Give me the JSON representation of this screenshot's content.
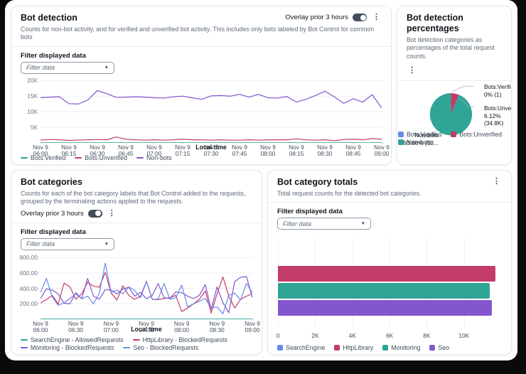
{
  "panels": {
    "bot_detection": {
      "title": "Bot detection",
      "subtitle": "Counts for non-bot activity, and for verified and unverified bot activity. This includes only bots labeled by Bot Control for common bots",
      "overlay_label": "Overlay prior 3 hours",
      "filter_label": "Filter displayed data",
      "filter_placeholder": "Filter data",
      "xaxis_title": "Local time",
      "legend": [
        {
          "label": "Bots:Verified",
          "color": "#2ea597"
        },
        {
          "label": "Bots:Unverified",
          "color": "#c33d69"
        },
        {
          "label": "Non-bots",
          "color": "#8456ce"
        }
      ]
    },
    "bot_detection_percentages": {
      "title": "Bot detection percentages",
      "subtitle": "Bot detection categories as percentages of the total request counts.",
      "legend": [
        {
          "label": "Bots:Verified",
          "color": "#688ae8"
        },
        {
          "label": "Bots:Unverified",
          "color": "#c33d69"
        },
        {
          "label": "Non-bots",
          "color": "#2ea597"
        }
      ]
    },
    "bot_categories": {
      "title": "Bot categories",
      "subtitle": "Counts for each of the bot category labels that Bot Control added to the requests, grouped by the terminating actions applied to the requests.",
      "overlay_label": "Overlay prior 3 hours",
      "filter_label": "Filter displayed data",
      "filter_placeholder": "Filter data",
      "xaxis_title": "Local time",
      "legend": [
        {
          "label": "SearchEngine - AllowedRequests",
          "color": "#2ea597"
        },
        {
          "label": "HttpLibrary - BlockedRequests",
          "color": "#c33d69"
        },
        {
          "label": "Monitoring - BlockedRequests",
          "color": "#8456ce"
        },
        {
          "label": "Seo - BlockedRequests",
          "color": "#688ae8"
        }
      ]
    },
    "bot_category_totals": {
      "title": "Bot category totals",
      "subtitle": "Total request counts for the detected bot categories.",
      "filter_label": "Filter displayed data",
      "filter_placeholder": "Filter data",
      "legend": [
        {
          "label": "SearchEngine",
          "color": "#688ae8"
        },
        {
          "label": "HttpLibrary",
          "color": "#c33d69"
        },
        {
          "label": "Monitoring",
          "color": "#2ea597"
        },
        {
          "label": "Seo",
          "color": "#8456ce"
        }
      ]
    }
  },
  "chart_data": {
    "bot_detection": {
      "type": "line",
      "ymax": 21000,
      "yticks": [
        {
          "label": "20K",
          "v": 20000
        },
        {
          "label": "15K",
          "v": 15000
        },
        {
          "label": "10K",
          "v": 10000
        },
        {
          "label": "5K",
          "v": 5000
        }
      ],
      "x_tick_labels": [
        [
          "Nov 9",
          "06:00"
        ],
        [
          "Nov 9",
          "06:15"
        ],
        [
          "Nov 9",
          "06:30"
        ],
        [
          "Nov 9",
          "06:45"
        ],
        [
          "Nov 9",
          "07:00"
        ],
        [
          "Nov 9",
          "07:15"
        ],
        [
          "Nov 9",
          "07:30"
        ],
        [
          "Nov 9",
          "07:45"
        ],
        [
          "Nov 9",
          "08:00"
        ],
        [
          "Nov 9",
          "08:15"
        ],
        [
          "Nov 9",
          "08:30"
        ],
        [
          "Nov 9",
          "08:45"
        ],
        [
          "Nov 9",
          "09:00"
        ]
      ],
      "xlabel": "Local time",
      "series": [
        {
          "name": "Bots:Verified",
          "color": "#2ea597",
          "values": [
            20,
            20,
            20,
            20,
            20,
            20,
            20,
            20,
            20,
            20,
            20,
            20,
            20,
            20,
            20,
            20,
            20,
            20,
            20,
            20,
            20,
            20,
            20,
            20,
            20,
            20,
            20,
            20,
            20,
            20,
            20,
            20,
            20,
            20,
            20,
            20,
            20
          ]
        },
        {
          "name": "Bots:Unverified",
          "color": "#c33d69",
          "values": [
            900,
            1100,
            1000,
            800,
            900,
            1000,
            1100,
            1000,
            1900,
            1200,
            1000,
            900,
            1000,
            900,
            1000,
            1200,
            1000,
            1000,
            900,
            1000,
            900,
            900,
            1000,
            900,
            1000,
            1000,
            1000,
            1300,
            1000,
            900,
            1000,
            700,
            1100,
            1200,
            1000,
            1400,
            1200
          ]
        },
        {
          "name": "Non-bots",
          "color": "#8456ce",
          "values": [
            14500,
            14700,
            14800,
            12600,
            12500,
            13800,
            16800,
            15800,
            14600,
            14700,
            14800,
            14700,
            14500,
            14400,
            14800,
            15000,
            14500,
            14000,
            15100,
            15200,
            15000,
            15600,
            14700,
            15600,
            14500,
            14400,
            14900,
            13100,
            14000,
            15200,
            16600,
            14800,
            12700,
            14200,
            13100,
            15500,
            11200
          ]
        }
      ]
    },
    "bot_detection_percentages": {
      "type": "pie",
      "slices": [
        {
          "name": "Bots:Verified",
          "pct": 0,
          "display_label": "Bots:Verified",
          "display_value": "0% (1)",
          "color": "#688ae8"
        },
        {
          "name": "Bots:Unverified",
          "pct": 6.12,
          "display_label": "Bots:Unverif...",
          "display_value": "6.12% (34.8K)",
          "color": "#c33d69"
        },
        {
          "name": "Non-bots",
          "pct": 93.88,
          "display_label": "Non-bots",
          "display_value": "93.88% (53...",
          "color": "#2ea597"
        }
      ]
    },
    "bot_categories": {
      "type": "line",
      "ymax": 850,
      "yticks": [
        {
          "label": "800.00",
          "v": 800
        },
        {
          "label": "600.00",
          "v": 600
        },
        {
          "label": "400.00",
          "v": 400
        },
        {
          "label": "200.00",
          "v": 200
        }
      ],
      "x_tick_labels": [
        [
          "Nov 9",
          "06:00"
        ],
        [
          "Nov 9",
          "06:30"
        ],
        [
          "Nov 9",
          "07:00"
        ],
        [
          "Nov 9",
          "07:30"
        ],
        [
          "Nov 9",
          "08:00"
        ],
        [
          "Nov 9",
          "08:30"
        ],
        [
          "Nov 9",
          "09:00"
        ]
      ],
      "xlabel": "Local time",
      "series": [
        {
          "name": "SearchEngine - AllowedRequests",
          "color": "#2ea597",
          "values": [
            2,
            2,
            2,
            2,
            2,
            2,
            2,
            2,
            2,
            2,
            2,
            2,
            2,
            2,
            2,
            2,
            2,
            2,
            2,
            2,
            2,
            2,
            2,
            2,
            2,
            2,
            2,
            2,
            2,
            2,
            2,
            2,
            2,
            2,
            2,
            2,
            2
          ]
        },
        {
          "name": "HttpLibrary - BlockedRequests",
          "color": "#c33d69",
          "values": [
            210,
            255,
            310,
            200,
            470,
            420,
            260,
            330,
            480,
            430,
            415,
            610,
            340,
            250,
            435,
            310,
            260,
            300,
            495,
            260,
            255,
            270,
            280,
            310,
            100,
            145,
            200,
            260,
            370,
            80,
            330,
            550,
            300,
            145,
            260,
            300,
            330
          ]
        },
        {
          "name": "Monitoring - BlockedRequests",
          "color": "#8456ce",
          "values": [
            270,
            395,
            380,
            330,
            210,
            200,
            345,
            265,
            530,
            300,
            260,
            385,
            380,
            330,
            395,
            415,
            300,
            350,
            265,
            310,
            465,
            280,
            270,
            355,
            345,
            300,
            270,
            310,
            450,
            130,
            420,
            215,
            85,
            490,
            545,
            555,
            280
          ]
        },
        {
          "name": "Seo - BlockedRequests",
          "color": "#688ae8",
          "values": [
            350,
            530,
            290,
            180,
            215,
            270,
            330,
            265,
            300,
            200,
            340,
            730,
            345,
            380,
            330,
            420,
            375,
            280,
            490,
            255,
            265,
            465,
            260,
            280,
            445,
            160,
            200,
            235,
            270,
            150,
            160,
            70,
            310,
            340,
            250,
            465,
            345
          ]
        }
      ]
    },
    "bot_category_totals": {
      "type": "bar",
      "xmax": 12000,
      "xticks": [
        {
          "label": "0",
          "v": 0
        },
        {
          "label": "2K",
          "v": 2000
        },
        {
          "label": "4K",
          "v": 4000
        },
        {
          "label": "6K",
          "v": 6000
        },
        {
          "label": "8K",
          "v": 8000
        },
        {
          "label": "10K",
          "v": 10000
        }
      ],
      "bars": [
        {
          "name": "SearchEngine",
          "color": "#688ae8",
          "value": 1
        },
        {
          "name": "HttpLibrary",
          "color": "#c33d69",
          "value": 11700
        },
        {
          "name": "Monitoring",
          "color": "#2ea597",
          "value": 11400
        },
        {
          "name": "Seo",
          "color": "#8456ce",
          "value": 11500
        }
      ]
    }
  }
}
